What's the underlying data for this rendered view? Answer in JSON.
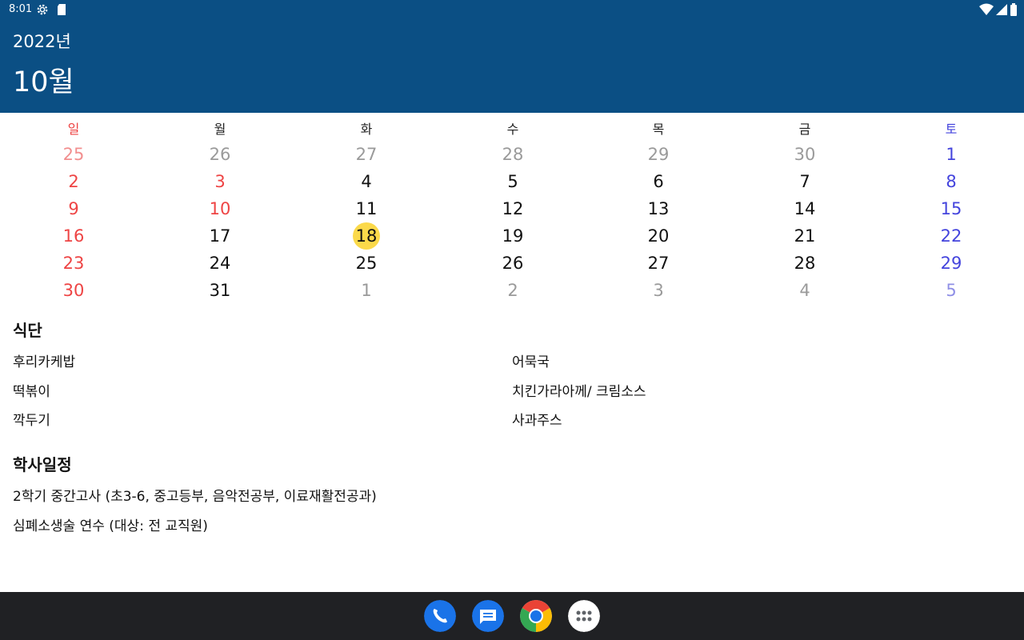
{
  "status_bar": {
    "time": "8:01",
    "icons": [
      "settings-icon",
      "sd-card-icon",
      "wifi-icon",
      "signal-icon",
      "battery-icon"
    ]
  },
  "header": {
    "year": "2022년",
    "month": "10월",
    "bg_color": "#0b4f84"
  },
  "weekdays": [
    "일",
    "월",
    "화",
    "수",
    "목",
    "금",
    "토"
  ],
  "calendar": {
    "today": "18",
    "highlight_color": "#fbd94a",
    "weeks": [
      [
        "25",
        "26",
        "27",
        "28",
        "29",
        "30",
        "1"
      ],
      [
        "2",
        "3",
        "4",
        "5",
        "6",
        "7",
        "8"
      ],
      [
        "9",
        "10",
        "11",
        "12",
        "13",
        "14",
        "15"
      ],
      [
        "16",
        "17",
        "18",
        "19",
        "20",
        "21",
        "22"
      ],
      [
        "23",
        "24",
        "25",
        "26",
        "27",
        "28",
        "29"
      ],
      [
        "30",
        "31",
        "1",
        "2",
        "3",
        "4",
        "5"
      ]
    ]
  },
  "meals": {
    "title": "식단",
    "items": [
      "후리카케밥",
      "어묵국",
      "떡볶이",
      "치킨가라아께/ 크림소스",
      "깍두기",
      "사과주스"
    ]
  },
  "schedule": {
    "title": "학사일정",
    "items": [
      "2학기 중간고사 (초3-6, 중고등부, 음악전공부, 이료재활전공과)",
      "심폐소생술 연수 (대상: 전 교직원)"
    ]
  },
  "dock": [
    "phone-icon",
    "messages-icon",
    "chrome-icon",
    "app-drawer-icon"
  ]
}
